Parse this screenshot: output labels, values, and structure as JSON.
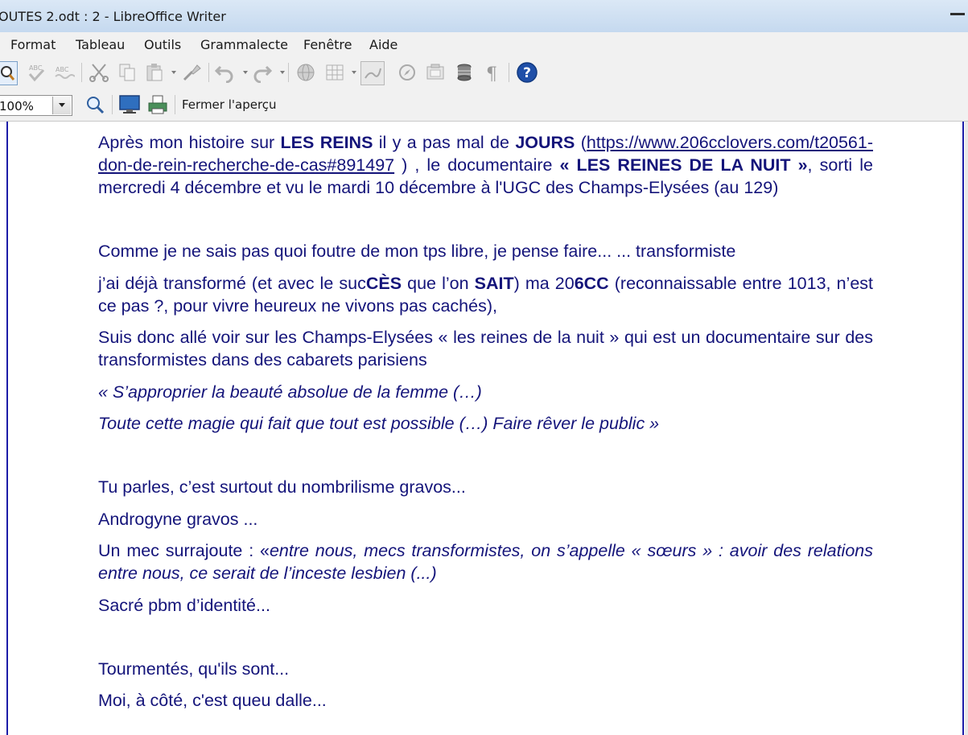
{
  "window": {
    "title": "OUTES  2.odt : 2 - LibreOffice Writer"
  },
  "menu": {
    "items": [
      {
        "label": "Format"
      },
      {
        "label": "Tableau"
      },
      {
        "label": "Outils"
      },
      {
        "label": "Grammalecte"
      },
      {
        "label": "Fenêtre"
      },
      {
        "label": "Aide"
      }
    ]
  },
  "toolbar": {
    "icons": [
      "print-preview-icon",
      "spellcheck-icon",
      "auto-spellcheck-icon",
      "cut-icon",
      "copy-icon",
      "paste-icon",
      "clone-formatting-icon",
      "undo-icon",
      "redo-icon",
      "hyperlink-icon",
      "table-icon",
      "show-draw-functions-icon",
      "navigator-icon",
      "gallery-icon",
      "data-sources-icon",
      "formatting-marks-icon",
      "help-icon"
    ]
  },
  "preview": {
    "zoom": "100%",
    "close_label": "Fermer l'aperçu"
  },
  "colors": {
    "text": "#14147a",
    "page_border": "#1c1ca8",
    "help_icon": "#1f4fa8"
  },
  "document": {
    "p1": {
      "a": "Après mon histoire sur ",
      "b": "LES REINS",
      "c": " il y a pas mal de ",
      "d": "JOURS",
      "e": " (",
      "link": "https://www.206cclovers.com/t20561-don-de-rein-recherche-de-cas#891497",
      "f": " ) , le documentaire ",
      "g": "« LES REINES DE LA NUIT »",
      "h": ", sorti le mercredi 4 décembre et vu le mardi 10 décembre à l'UGC des Champs-Elysées (au 129)"
    },
    "p2": "Comme je ne sais pas quoi foutre de mon tps libre, je pense faire... ... transformiste",
    "p3": {
      "a": "j’ai déjà transformé (et avec le suc",
      "b": "CÈS",
      "c": " que l’on ",
      "d": "SAIT",
      "e": ") ma 20",
      "f": "6CC",
      "g": " (reconnaissable entre 1013, n’est ce pas ?, pour vivre heureux ne vivons pas cachés),"
    },
    "p4": "Suis donc allé voir sur les Champs-Elysées « les reines de la nuit » qui est un documentaire sur des transformistes dans des cabarets parisiens",
    "p5": "« S’approprier la beauté absolue de la femme (…)",
    "p6": "Toute cette magie qui fait que tout est possible (…) Faire rêver le public »",
    "p7": "Tu parles, c’est surtout du nombrilisme gravos...",
    "p8": "Androgyne gravos ...",
    "p9": {
      "a": "Un mec surrajoute : «",
      "b": "entre nous, mecs transformistes, on s’appelle « sœurs » : avoir des relations entre nous, ce serait de l’inceste lesbien (...)"
    },
    "p10": "Sacré pbm d’identité...",
    "p11": "Tourmentés, qu'ils sont...",
    "p12": "Moi, à côté, c'est queu dalle..."
  }
}
